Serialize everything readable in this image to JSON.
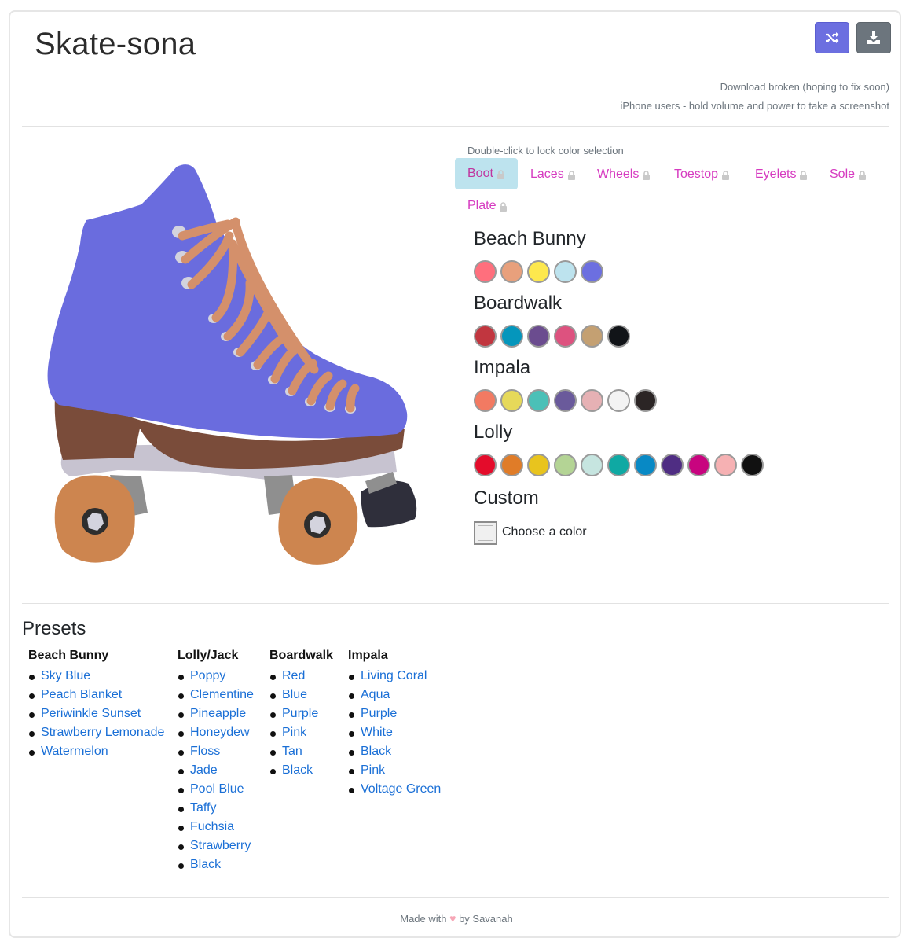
{
  "app": {
    "title": "Skate-sona"
  },
  "toolbar": {
    "shuffle_icon": "shuffle-icon",
    "download_icon": "download-icon"
  },
  "notes": {
    "line1": "Download broken (hoping to fix soon)",
    "line2": "iPhone users - hold volume and power to take a screenshot"
  },
  "editor": {
    "hint": "Double-click to lock color selection",
    "tabs": [
      {
        "label": "Boot",
        "active": true
      },
      {
        "label": "Laces"
      },
      {
        "label": "Wheels"
      },
      {
        "label": "Toestop"
      },
      {
        "label": "Eyelets"
      },
      {
        "label": "Sole"
      },
      {
        "label": "Plate"
      }
    ],
    "palettes": [
      {
        "name": "Beach Bunny",
        "colors": [
          "#ff6f7d",
          "#e8a07c",
          "#fde84e",
          "#bde3ee",
          "#6c6fe0"
        ]
      },
      {
        "name": "Boardwalk",
        "colors": [
          "#c1363f",
          "#0496bc",
          "#6b4c8f",
          "#dd527f",
          "#c4a072",
          "#111418"
        ]
      },
      {
        "name": "Impala",
        "colors": [
          "#f27a62",
          "#e6d95a",
          "#4bc0b7",
          "#6a5a9b",
          "#e6b1b4",
          "#f3f3f3",
          "#2b2525"
        ]
      },
      {
        "name": "Lolly",
        "colors": [
          "#e40c2b",
          "#e07c28",
          "#e8c41e",
          "#b4d495",
          "#c6e5e0",
          "#0fa9a3",
          "#0889c5",
          "#4f2d83",
          "#c8047f",
          "#f6b1b3",
          "#111111"
        ]
      }
    ],
    "custom": {
      "title": "Custom",
      "label": "Choose a color"
    }
  },
  "skate": {
    "boot": "#6a6cde",
    "laces": "#d4906b",
    "wheels": "#cd854f",
    "toestop": "#2f2f3b",
    "eyelets": "#d3d3de",
    "sole": "#7a4c3a",
    "plate": "#c7c3d0"
  },
  "presets": {
    "title": "Presets",
    "columns": [
      {
        "heading": "Beach Bunny",
        "items": [
          "Sky Blue",
          "Peach Blanket",
          "Periwinkle Sunset",
          "Strawberry Lemonade",
          "Watermelon"
        ]
      },
      {
        "heading": "Lolly/Jack",
        "items": [
          "Poppy",
          "Clementine",
          "Pineapple",
          "Honeydew",
          "Floss",
          "Jade",
          "Pool Blue",
          "Taffy",
          "Fuchsia",
          "Strawberry",
          "Black"
        ]
      },
      {
        "heading": "Boardwalk",
        "items": [
          "Red",
          "Blue",
          "Purple",
          "Pink",
          "Tan",
          "Black"
        ]
      },
      {
        "heading": "Impala",
        "items": [
          "Living Coral",
          "Aqua",
          "Purple",
          "White",
          "Black",
          "Pink",
          "Voltage Green"
        ]
      }
    ]
  },
  "footer": {
    "made_with": "Made with",
    "by": "by Savanah"
  }
}
